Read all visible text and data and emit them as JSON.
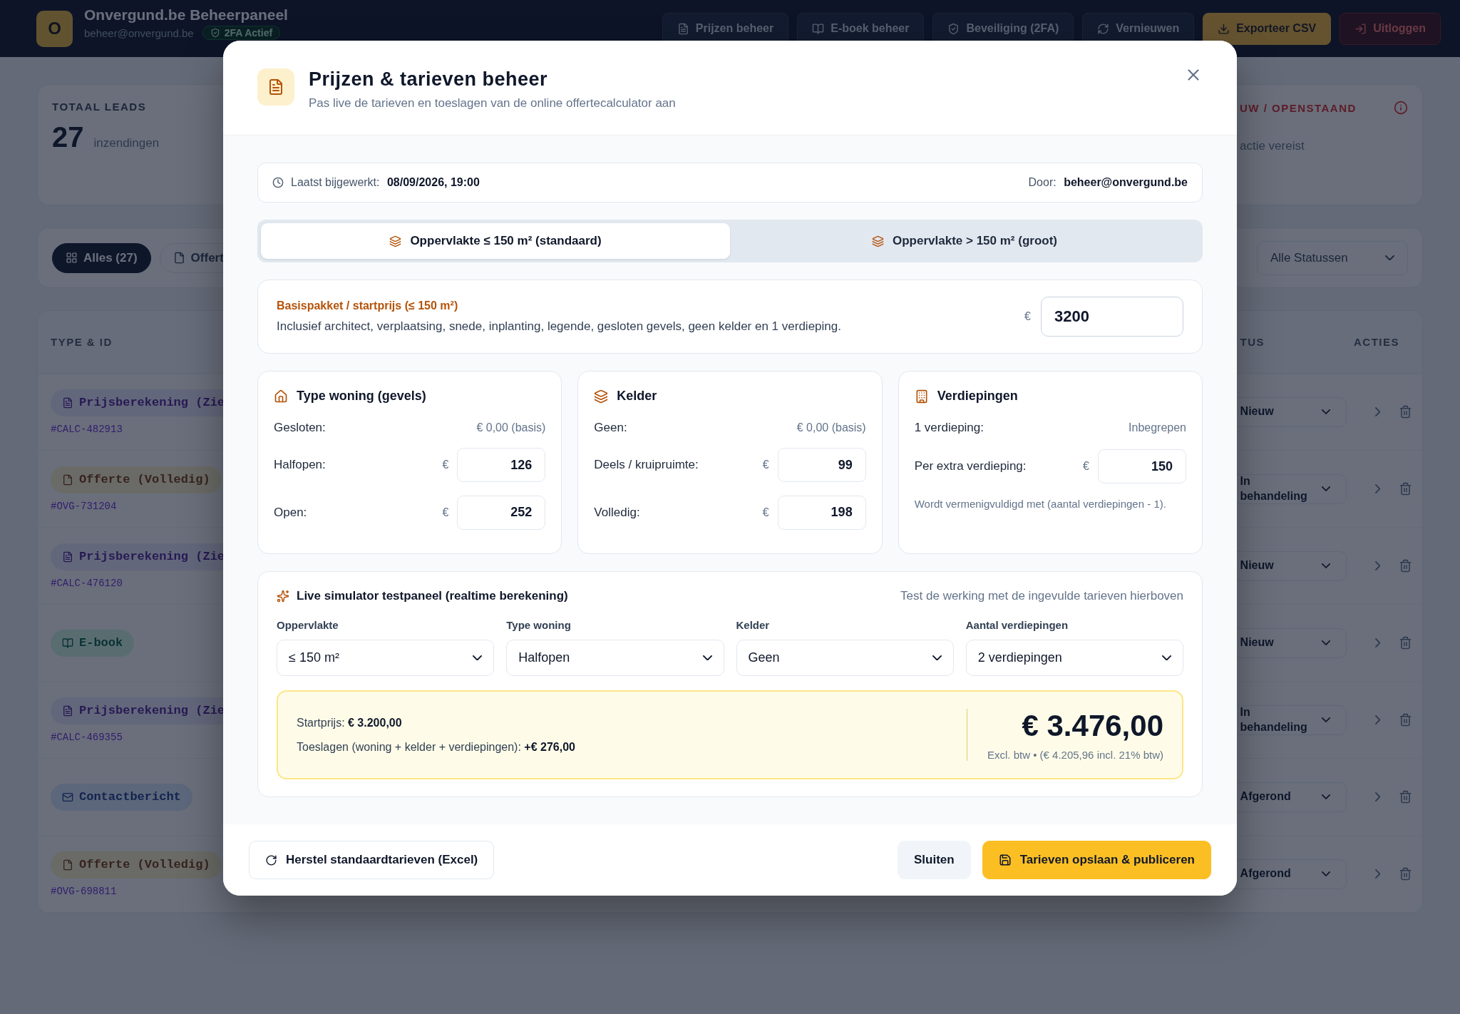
{
  "header": {
    "logo_letter": "O",
    "title": "Onvergund.be Beheerpaneel",
    "email": "beheer@onvergund.be",
    "badge": "2FA Actief",
    "buttons": [
      {
        "label": "Prijzen beheer",
        "kind": "prices"
      },
      {
        "label": "E-boek beheer",
        "kind": "ebook"
      },
      {
        "label": "Beveiliging (2FA)",
        "kind": "security"
      },
      {
        "label": "Vernieuwen",
        "kind": "refresh"
      },
      {
        "label": "Exporteer CSV",
        "kind": "export"
      },
      {
        "label": "Uitloggen",
        "kind": "logout"
      }
    ]
  },
  "stats": {
    "total_label": "TOTAAL LEADS",
    "total_value": "27",
    "total_caption": "inzendingen",
    "open_label": "UW / OPENSTAAND",
    "open_caption": "actie vereist"
  },
  "filters": {
    "tabs": [
      {
        "label": "Alles (27)",
        "selected": true,
        "kind": "all"
      },
      {
        "label": "Offert",
        "selected": false,
        "kind": "offerte"
      }
    ],
    "status_select": "Alle Statussen"
  },
  "table": {
    "columns": [
      "TYPE & ID",
      "TUS",
      "ACTIES"
    ],
    "rows": [
      {
        "type": "Prijsberekening (Zie",
        "kind": "calc",
        "id": "#CALC-482913",
        "status": "Nieuw"
      },
      {
        "type": "Offerte (Volledig)",
        "kind": "offerte",
        "id": "#OVG-731204",
        "status": "In behandeling"
      },
      {
        "type": "Prijsberekening (Zie",
        "kind": "calc",
        "id": "#CALC-476120",
        "status": "Nieuw"
      },
      {
        "type": "E-book",
        "kind": "ebook",
        "status": "Nieuw"
      },
      {
        "type": "Prijsberekening (Zie",
        "kind": "calc",
        "id": "#CALC-469355",
        "status": "In behandeling"
      },
      {
        "type": "Contactbericht",
        "kind": "contact",
        "status": "Afgerond"
      },
      {
        "type": "Offerte (Volledig)",
        "kind": "offerte",
        "id": "#OVG-698811",
        "status": "Afgerond"
      }
    ]
  },
  "modal": {
    "title": "Prijzen & tarieven beheer",
    "subtitle": "Pas live de tarieven en toeslagen van de online offertecalculator aan",
    "info": {
      "updated": "Laatst bijgewerkt: **08/09/2026, 19:00**",
      "by": "Door: **beheer@onvergund.be**"
    },
    "tabs": [
      {
        "label": "Oppervlakte ≤ 150 m² (standaard)",
        "selected": true
      },
      {
        "label": "Oppervlakte > 150 m² (groot)",
        "selected": false
      }
    ],
    "base": {
      "title": "Basispakket / startprijs (≤ 150 m²)",
      "description": "Inclusief architect, verplaatsing, snede, inplanting, legende, gesloten gevels, geen kelder en 1 verdieping.",
      "currency": "€",
      "value": "3200"
    },
    "cards": [
      {
        "title": "Type woning (gevels)",
        "kind": "house",
        "rows": [
          {
            "label": "Gesloten:",
            "kind": "fixed",
            "value": "€ 0,00 (basis)"
          },
          {
            "label": "Halfopen:",
            "kind": "input",
            "currency": "€",
            "value": "126"
          },
          {
            "label": "Open:",
            "kind": "input",
            "currency": "€",
            "value": "252"
          }
        ]
      },
      {
        "title": "Kelder",
        "kind": "layers",
        "rows": [
          {
            "label": "Geen:",
            "kind": "fixed",
            "value": "€ 0,00 (basis)"
          },
          {
            "label": "Deels / kruipruimte:",
            "kind": "input",
            "currency": "€",
            "value": "99"
          },
          {
            "label": "Volledig:",
            "kind": "input",
            "currency": "€",
            "value": "198"
          }
        ]
      },
      {
        "title": "Verdiepingen",
        "kind": "building",
        "rows": [
          {
            "label": "1 verdieping:",
            "kind": "fixed",
            "value": "Inbegrepen"
          },
          {
            "label": "Per extra verdieping:",
            "kind": "input",
            "currency": "€",
            "value": "150"
          }
        ],
        "note": "Wordt vermenigvuldigd met (aantal verdiepingen - 1)."
      }
    ],
    "simulator": {
      "title": "Live simulator testpaneel (realtime berekening)",
      "hint": "Test de werking met de ingevulde tarieven hierboven",
      "fields": [
        {
          "label": "Oppervlakte",
          "value": "≤ 150 m²"
        },
        {
          "label": "Type woning",
          "value": "Halfopen"
        },
        {
          "label": "Kelder",
          "value": "Geen"
        },
        {
          "label": "Aantal verdiepingen",
          "value": "2 verdiepingen"
        }
      ],
      "start": "Startprijs: **€ 3.200,00**",
      "extras": "Toeslagen (woning + kelder + verdiepingen): **+€ 276,00**",
      "total": "€ 3.476,00",
      "total_note": "Excl. btw • (€ 4.205,96 incl. 21% btw)"
    },
    "footer": {
      "reset": "Herstel standaardtarieven (Excel)",
      "close": "Sluiten",
      "save": "Tarieven opslaan & publiceren"
    }
  }
}
